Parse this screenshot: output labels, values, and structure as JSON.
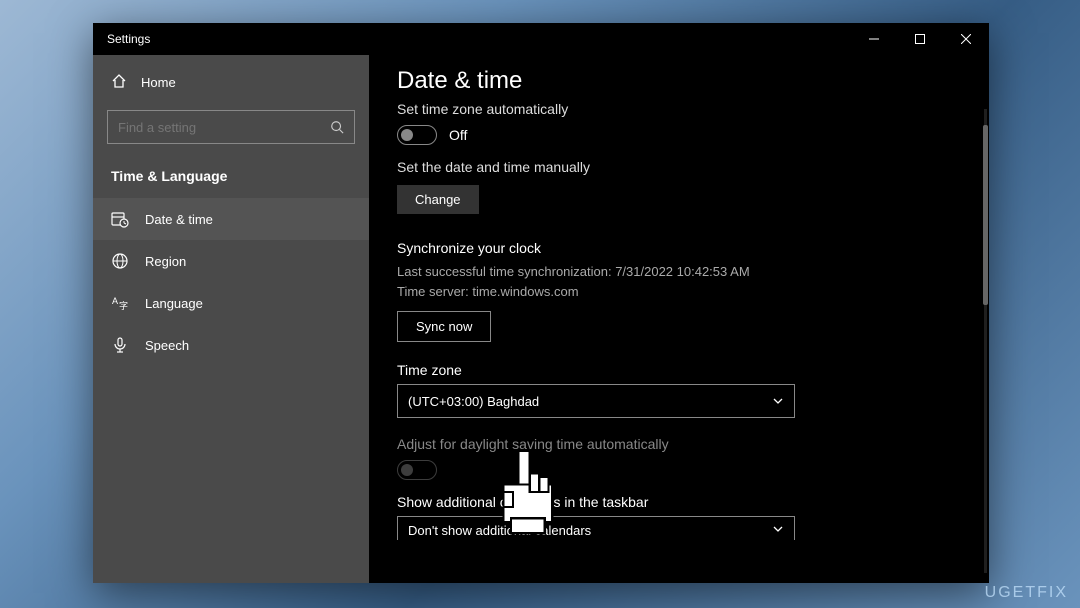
{
  "window": {
    "title": "Settings"
  },
  "sidebar": {
    "home": "Home",
    "search_placeholder": "Find a setting",
    "category": "Time & Language",
    "items": [
      {
        "label": "Date & time"
      },
      {
        "label": "Region"
      },
      {
        "label": "Language"
      },
      {
        "label": "Speech"
      }
    ]
  },
  "main": {
    "title": "Date & time",
    "auto_tz_label": "Set time zone automatically",
    "auto_tz_state": "Off",
    "manual_label": "Set the date and time manually",
    "change_btn": "Change",
    "sync_title": "Synchronize your clock",
    "sync_last": "Last successful time synchronization: 7/31/2022 10:42:53 AM",
    "sync_server": "Time server: time.windows.com",
    "sync_btn": "Sync now",
    "tz_title": "Time zone",
    "tz_value": "(UTC+03:00) Baghdad",
    "dst_label": "Adjust for daylight saving time automatically",
    "calendars_title": "Show additional calendars in the taskbar",
    "calendars_value": "Don't show additional calendars"
  },
  "watermark": "UGETFIX"
}
